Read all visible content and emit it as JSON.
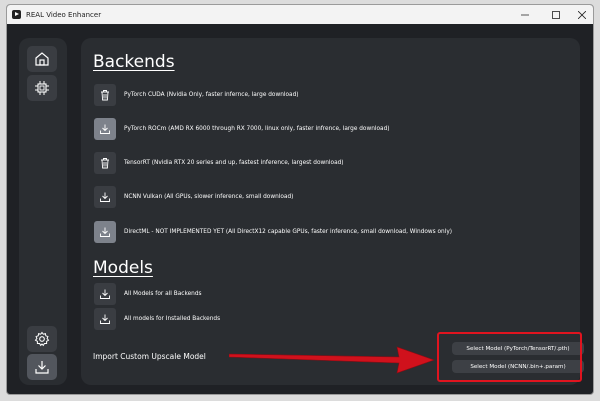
{
  "window": {
    "title": "REAL Video Enhancer"
  },
  "sidebar": {
    "items": [
      {
        "icon": "home-icon"
      },
      {
        "icon": "chip-icon"
      },
      {
        "icon": "gear-icon"
      },
      {
        "icon": "download-icon"
      }
    ]
  },
  "backends": {
    "heading": "Backends",
    "items": [
      {
        "label": "PyTorch CUDA (Nvidia Only, faster infernce, large download)",
        "icon": "trash-icon"
      },
      {
        "label": "PyTorch ROCm (AMD RX 6000 through RX 7000, linux only, faster infrence, large download)",
        "icon": "download-icon"
      },
      {
        "label": "TensorRT (Nvidia RTX 20 series and up, fastest inference, largest download)",
        "icon": "trash-icon"
      },
      {
        "label": "NCNN Vulkan (All GPUs, slower inference, small download)",
        "icon": "download-icon"
      },
      {
        "label": "DirectML - NOT IMPLEMENTED YET (All DirectX12 capable GPUs, faster inference, small download, Windows only)",
        "icon": "download-icon"
      }
    ]
  },
  "models": {
    "heading": "Models",
    "items": [
      {
        "label": "All Models for all Backends",
        "icon": "download-icon"
      },
      {
        "label": "All models for Installed Backends",
        "icon": "download-icon"
      }
    ]
  },
  "import": {
    "label": "Import Custom Upscale Model",
    "pytorch_button": "Select Model (PyTorch/TensorRT/.pth)",
    "ncnn_button": "Select Model (NCNN/.bin+.param)"
  },
  "colors": {
    "highlight": "#e0141f",
    "background": "#1f2125",
    "panel": "#2a2d31"
  }
}
